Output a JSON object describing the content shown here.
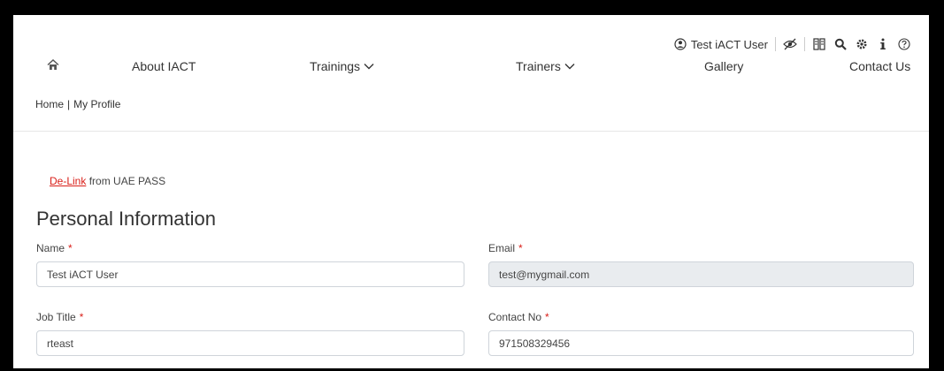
{
  "topbar": {
    "user_name": "Test iACT User",
    "icons": [
      "user-circle-icon",
      "eye-slash-icon",
      "sign-language-icon",
      "search-icon",
      "gear-icon",
      "info-icon",
      "help-circle-icon"
    ]
  },
  "nav": {
    "home_icon": "home-icon",
    "about": "About IACT",
    "trainings": "Trainings",
    "trainers": "Trainers",
    "gallery": "Gallery",
    "contact": "Contact Us"
  },
  "breadcrumb": {
    "home": "Home",
    "separator": "|",
    "current": "My Profile"
  },
  "delink": {
    "link_text": "De-Link",
    "rest_text": "from UAE PASS"
  },
  "section": {
    "title": "Personal Information"
  },
  "form": {
    "name": {
      "label": "Name",
      "required_mark": "*",
      "value": "Test iACT User"
    },
    "email": {
      "label": "Email",
      "required_mark": "*",
      "value": "test@mygmail.com"
    },
    "job_title": {
      "label": "Job Title",
      "required_mark": "*",
      "value": "rteast"
    },
    "contact_no": {
      "label": "Contact No",
      "required_mark": "*",
      "value": "971508329456"
    }
  },
  "colors": {
    "accent_red": "#d91e18",
    "disabled_bg": "#e9ecef",
    "border": "#cfd4da"
  }
}
